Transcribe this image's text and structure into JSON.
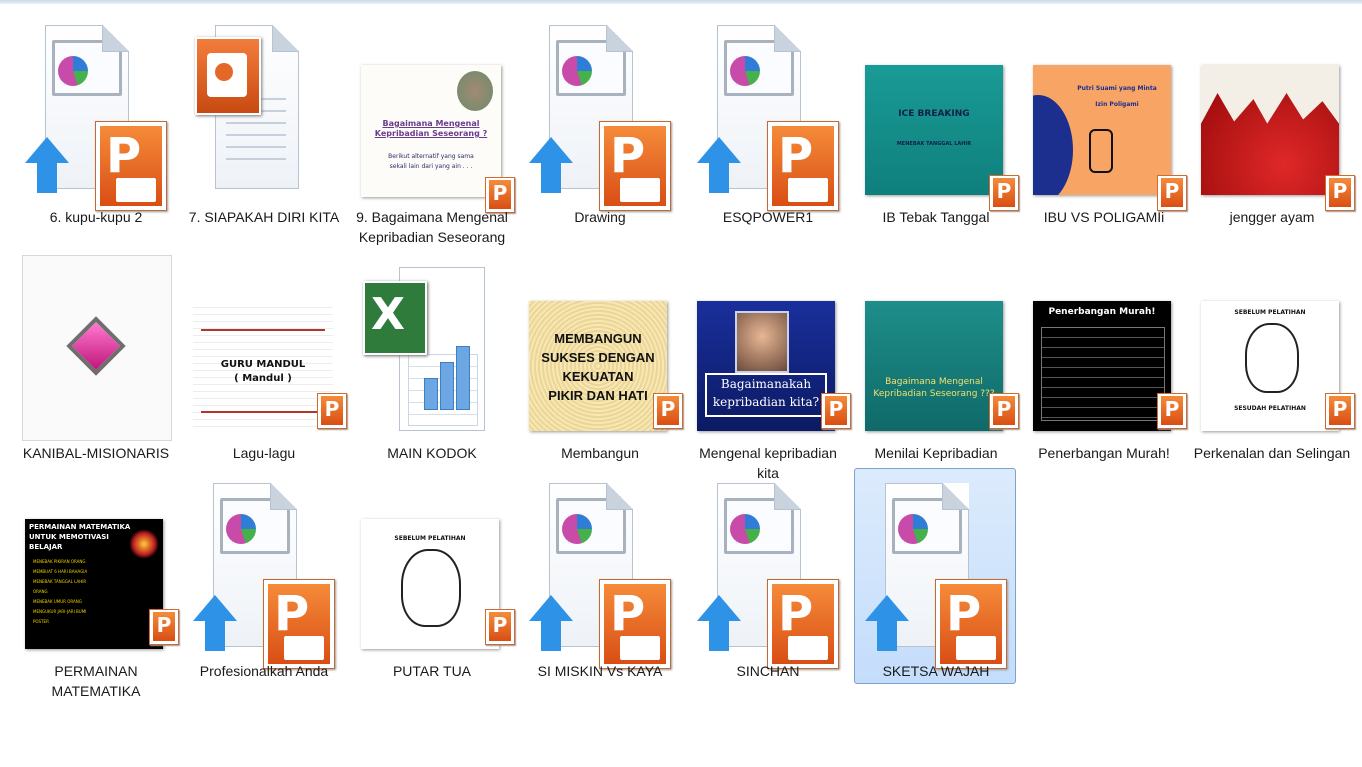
{
  "window": {
    "accent": "#c4ddfb"
  },
  "files": [
    {
      "name": "6. kupu-kupu 2",
      "type": "pptx-icon"
    },
    {
      "name": "7. SIAPAKAH DIRI KITA",
      "type": "ppt-doc"
    },
    {
      "name": "9. Bagaimana Mengenal Kepribadian Seseorang",
      "type": "slide",
      "slide_text": [
        "Bagaimana Mengenal",
        "Kepribadian Seseorang ?",
        "Berikut alternatif yang sama",
        "sekali lain dari yang ain . . ."
      ]
    },
    {
      "name": "Drawing",
      "type": "pptx-icon"
    },
    {
      "name": "ESQPOWER1",
      "type": "pptx-icon"
    },
    {
      "name": "IB Tebak Tanggal",
      "type": "slide",
      "slide_text": [
        "ICE BREAKING",
        "MENEBAK TANGGAL LAHIR"
      ]
    },
    {
      "name": "IBU VS POLIGAMIi",
      "type": "slide",
      "slide_text": [
        "Putri Suami yang Minta",
        "Izin Poligami"
      ]
    },
    {
      "name": "jengger ayam",
      "type": "slide"
    },
    {
      "name": "KANIBAL-MISIONARIS",
      "type": "app"
    },
    {
      "name": "Lagu-lagu",
      "type": "slide",
      "slide_text": [
        "GURU MANDUL",
        "( Mandul )"
      ]
    },
    {
      "name": "MAIN KODOK",
      "type": "excel"
    },
    {
      "name": "Membangun",
      "type": "slide",
      "slide_text": [
        "MEMBANGUN",
        "SUKSES DENGAN",
        "KEKUATAN",
        "PIKIR DAN HATI"
      ]
    },
    {
      "name": "Mengenal kepribadian kita",
      "type": "slide",
      "slide_text": [
        "Bagaimanakah",
        "kepribadian kita?"
      ]
    },
    {
      "name": "Menilai Kepribadian",
      "type": "slide",
      "slide_text": [
        "Bagaimana Mengenal",
        "Kepribadian Seseorang ???"
      ]
    },
    {
      "name": "Penerbangan Murah!",
      "type": "slide",
      "slide_text": [
        "Penerbangan Murah!"
      ]
    },
    {
      "name": "Perkenalan dan Selingan",
      "type": "slide",
      "slide_text": [
        "SEBELUM PELATIHAN",
        "SESUDAH PELATIHAN"
      ]
    },
    {
      "name": "PERMAINAN MATEMATIKA",
      "type": "slide",
      "slide_text": [
        "PERMAINAN MATEMATIKA",
        "UNTUK MEMOTIVASI",
        "BELAJAR",
        "MENEBAK PIKIRAN ORANG",
        "MEMBUAT 6 HARI BAHAGIA",
        "MENEBAK TANGGAL LAHIR",
        "ORANG",
        "MENEBAK UMUR ORANG",
        "MENGUKUR JARI-JARI BUMI",
        "POSTER"
      ]
    },
    {
      "name": "Profesionalkah Anda",
      "type": "pptx-icon"
    },
    {
      "name": "PUTAR TUA",
      "type": "slide",
      "slide_text": [
        "SEBELUM PELATIHAN"
      ]
    },
    {
      "name": "SI MISKIN Vs KAYA",
      "type": "pptx-icon"
    },
    {
      "name": "SINCHAN",
      "type": "pptx-icon"
    },
    {
      "name": "SKETSA WAJAH",
      "type": "pptx-icon",
      "selected": true
    }
  ]
}
